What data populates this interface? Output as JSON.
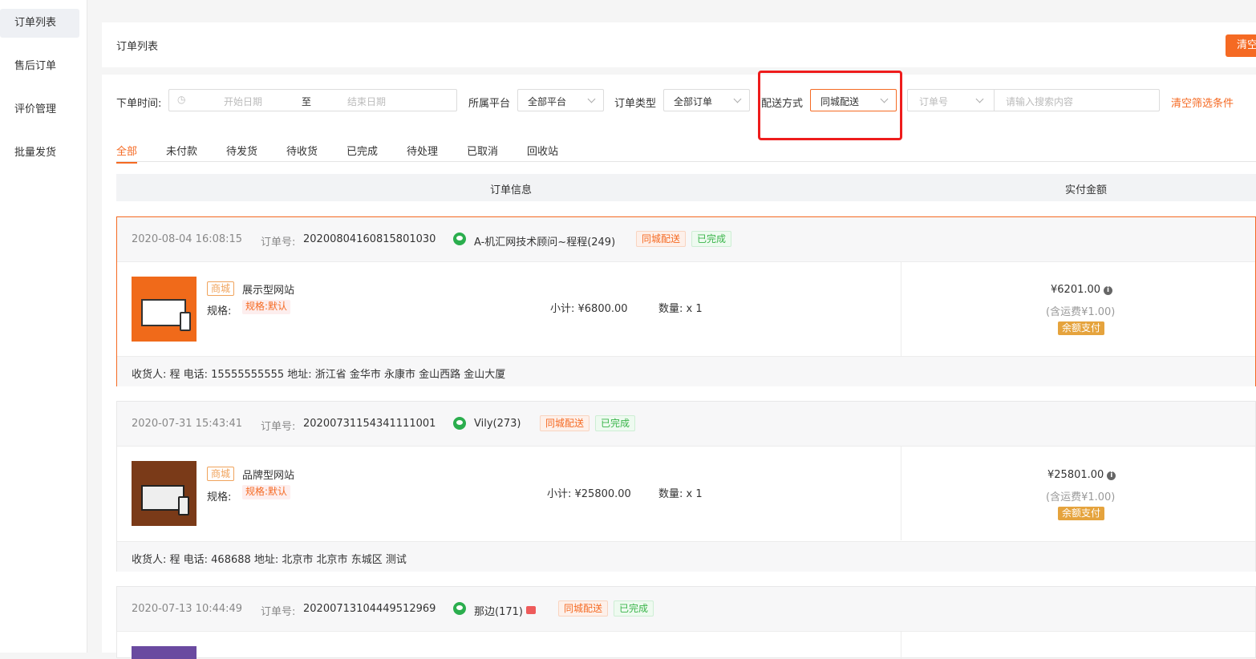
{
  "sidebar": {
    "items": [
      {
        "label": "订单列表"
      },
      {
        "label": "售后订单"
      },
      {
        "label": "评价管理"
      },
      {
        "label": "批量发货"
      }
    ]
  },
  "header": {
    "title": "订单列表",
    "clear_button": "清空"
  },
  "filters": {
    "order_time_label": "下单时间:",
    "start_placeholder": "开始日期",
    "range_sep": "至",
    "end_placeholder": "结束日期",
    "platform_label": "所属平台",
    "platform_value": "全部平台",
    "type_label": "订单类型",
    "type_value": "全部订单",
    "delivery_label": "配送方式",
    "delivery_value": "同城配送",
    "search_field_value": "订单号",
    "search_placeholder": "请输入搜索内容",
    "clear_filters": "清空筛选条件"
  },
  "tabs": [
    {
      "label": "全部"
    },
    {
      "label": "未付款"
    },
    {
      "label": "待发货"
    },
    {
      "label": "待收货"
    },
    {
      "label": "已完成"
    },
    {
      "label": "待处理"
    },
    {
      "label": "已取消"
    },
    {
      "label": "回收站"
    }
  ],
  "table_header": {
    "order_info": "订单信息",
    "paid_amount": "实付金额"
  },
  "orders": [
    {
      "time": "2020-08-04 16:08:15",
      "order_no_label": "订单号:",
      "order_no": "20200804160815801030",
      "customer": "A-机汇网技术顾问~程程(249)",
      "delivery_badge": "同城配送",
      "status_badge": "已完成",
      "shop_tag": "商城",
      "product_name": "展示型网站",
      "spec_label": "规格:",
      "spec_value": "规格:默认",
      "subtotal": "小计: ¥6800.00",
      "quantity": "数量: x 1",
      "paid": "¥6201.00",
      "shipping": "(含运费¥1.00)",
      "pay_method": "余额支付",
      "address": "收货人: 程 电话: 15555555555 地址: 浙江省 金华市 永康市 金山西路 金山大厦",
      "thumb_color": "#f06a1a"
    },
    {
      "time": "2020-07-31 15:43:41",
      "order_no_label": "订单号:",
      "order_no": "20200731154341111001",
      "customer": "Vily(273)",
      "delivery_badge": "同城配送",
      "status_badge": "已完成",
      "shop_tag": "商城",
      "product_name": "品牌型网站",
      "spec_label": "规格:",
      "spec_value": "规格:默认",
      "subtotal": "小计: ¥25800.00",
      "quantity": "数量: x 1",
      "paid": "¥25801.00",
      "shipping": "(含运费¥1.00)",
      "pay_method": "余额支付",
      "address": "收货人: 程 电话: 468688 地址: 北京市 北京市 东城区 测试",
      "thumb_color": "#7a3a18"
    },
    {
      "time": "2020-07-13 10:44:49",
      "order_no_label": "订单号:",
      "order_no": "20200713104449512969",
      "customer": "那边(171)",
      "delivery_badge": "同城配送",
      "status_badge": "已完成",
      "thumb_color": "#6a4aa0"
    }
  ]
}
